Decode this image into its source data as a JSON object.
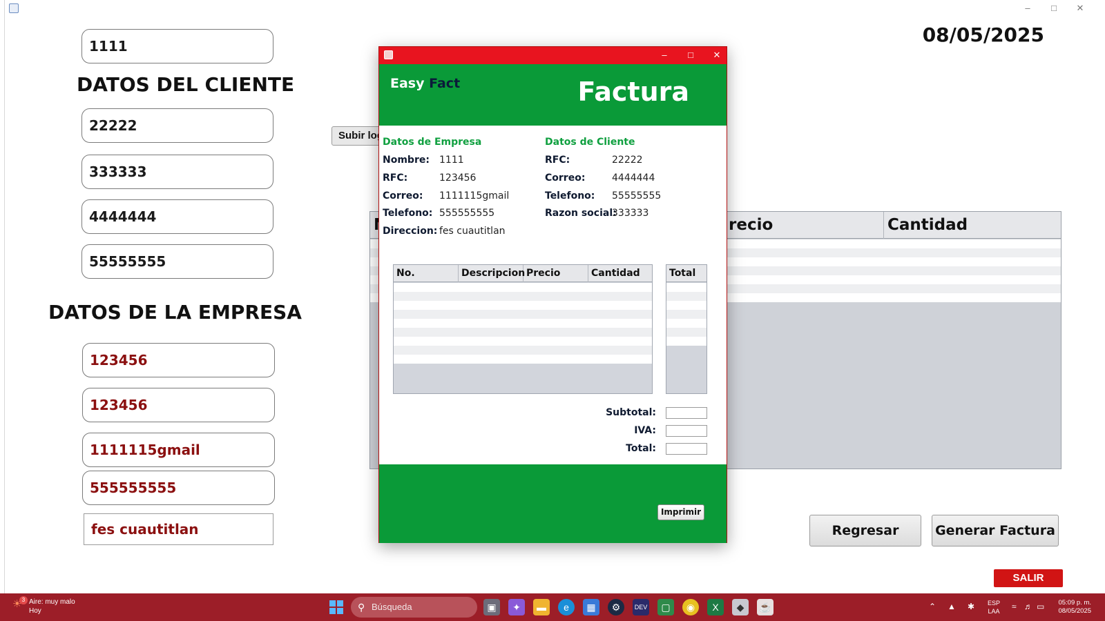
{
  "main": {
    "date": "08/05/2025",
    "client_section_title": "DATOS DEL CLIENTE",
    "company_section_title": "DATOS DE LA EMPRESA",
    "fields": {
      "top": "1111",
      "client_rfc": "22222",
      "client_razon": "333333",
      "client_email": "4444444",
      "client_phone": "55555555",
      "company_1": "123456",
      "company_2": "123456",
      "company_email": "1111115gmail",
      "company_phone": "555555555",
      "company_address": "fes cuautitlan"
    },
    "upload_logo_label": "Subir logo",
    "table_columns": [
      "N",
      "recio",
      "Cantidad"
    ],
    "back_label": "Regresar",
    "generate_label": "Generar Factura",
    "exit_label": "SALIR"
  },
  "dialog": {
    "brand_easy": "Easy",
    "brand_fact": "Fact",
    "title": "Factura",
    "company": {
      "heading": "Datos de Empresa",
      "rows": [
        {
          "label": "Nombre:",
          "value": "1111"
        },
        {
          "label": "RFC:",
          "value": "123456"
        },
        {
          "label": "Correo:",
          "value": "1111115gmail"
        },
        {
          "label": "Telefono:",
          "value": "555555555"
        },
        {
          "label": "Direccion:",
          "value": "fes cuautitlan"
        }
      ]
    },
    "client": {
      "heading": "Datos de Cliente",
      "rows": [
        {
          "label": "RFC:",
          "value": "22222"
        },
        {
          "label": "Correo:",
          "value": "4444444"
        },
        {
          "label": "Telefono:",
          "value": "55555555"
        },
        {
          "label": "Razon social:",
          "value": "333333"
        }
      ]
    },
    "items_columns": [
      "No.",
      "Descripcion",
      "Precio",
      "Cantidad"
    ],
    "total_column": "Total",
    "subtotal_label": "Subtotal:",
    "iva_label": "IVA:",
    "total_label": "Total:",
    "print_label": "Imprimir"
  },
  "taskbar": {
    "weather_badge": "3",
    "weather_line1": "Aire: muy malo",
    "weather_line2": "Hoy",
    "search_placeholder": "Búsqueda",
    "lang_line1": "ESP",
    "lang_line2": "LAA",
    "time": "05:09 p. m.",
    "date": "08/05/2025"
  },
  "colors": {
    "dialog_green": "#0a9a38",
    "dialog_titlebar_red": "#e8141f",
    "company_text_red": "#8b1010",
    "exit_red": "#d11414",
    "taskbar": "#9c1e28"
  }
}
